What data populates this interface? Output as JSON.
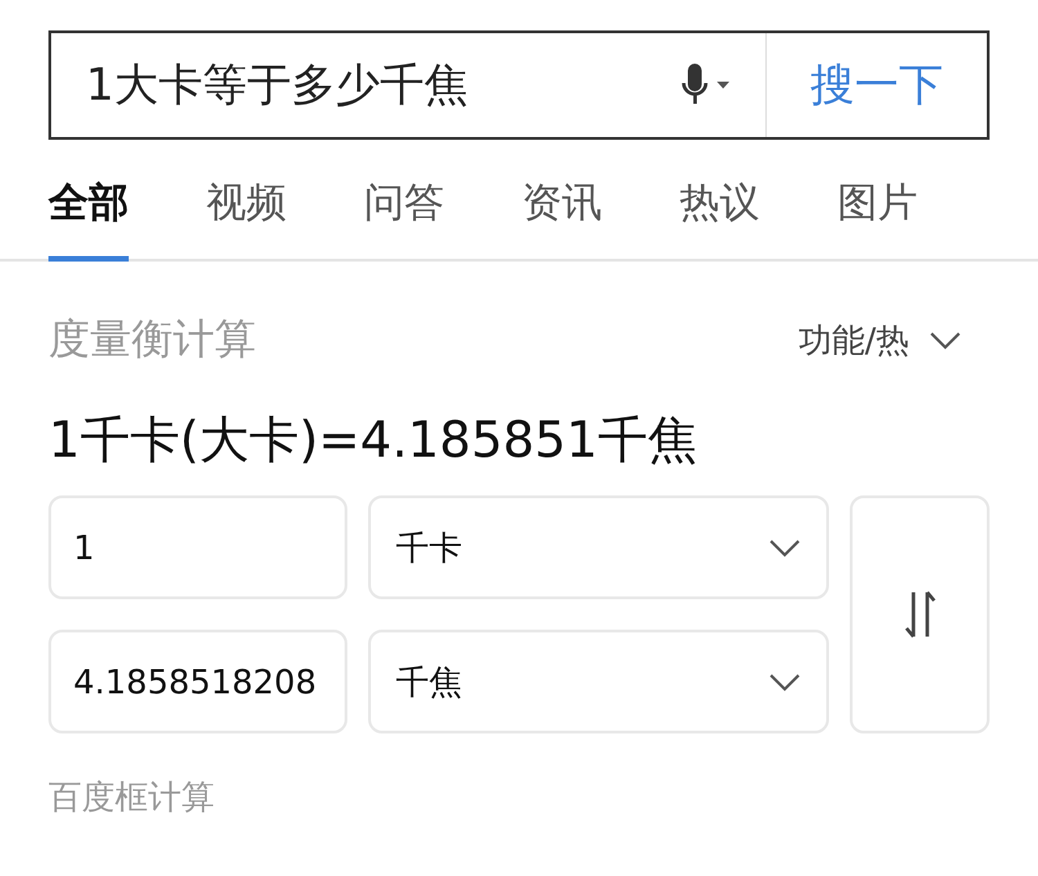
{
  "search": {
    "value": "1大卡等于多少千焦",
    "button": "搜一下"
  },
  "tabs": [
    {
      "label": "全部",
      "selected": true
    },
    {
      "label": "视频",
      "selected": false
    },
    {
      "label": "问答",
      "selected": false
    },
    {
      "label": "资讯",
      "selected": false
    },
    {
      "label": "热议",
      "selected": false
    },
    {
      "label": "图片",
      "selected": false
    }
  ],
  "converter": {
    "title": "度量衡计算",
    "category": "功能/热",
    "result": "1千卡(大卡)=4.185851千焦",
    "rows": [
      {
        "value": "1",
        "unit": "千卡"
      },
      {
        "value": "4.1858518208",
        "unit": "千焦"
      }
    ]
  },
  "footer": "百度框计算"
}
